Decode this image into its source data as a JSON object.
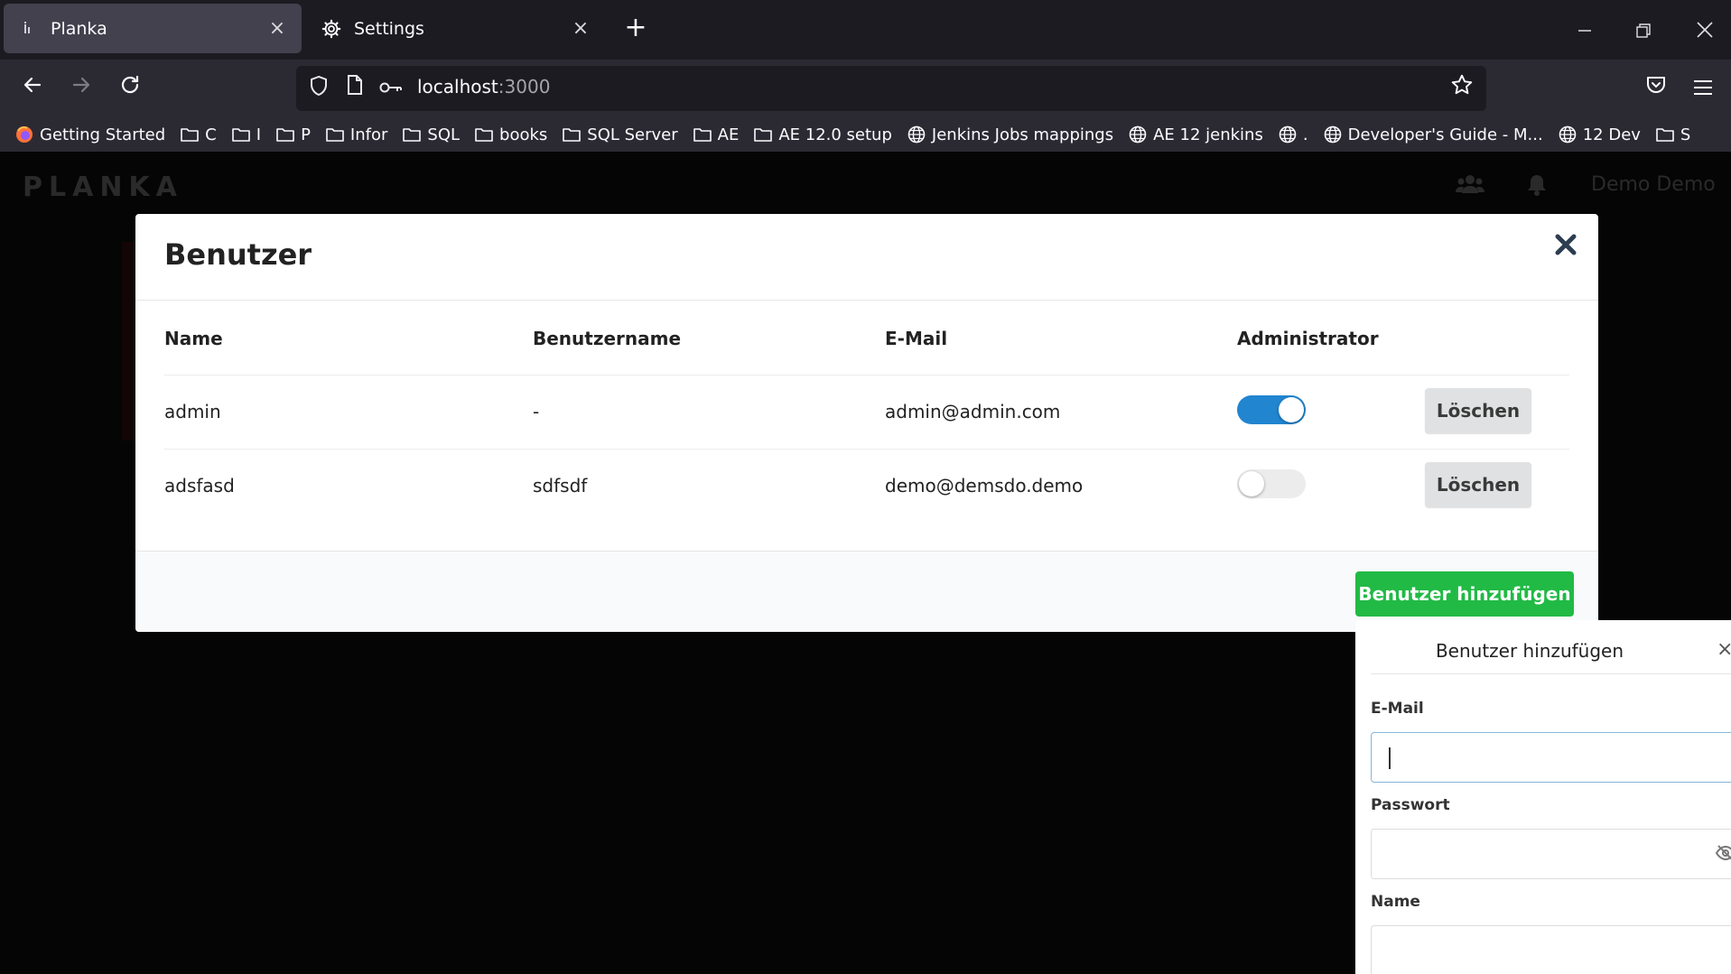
{
  "browser": {
    "tabs": [
      {
        "label": "Planka",
        "favicon": "planka-favicon-icon",
        "active": true
      },
      {
        "label": "Settings",
        "favicon": "gear-icon",
        "active": false
      }
    ],
    "url_host": "localhost",
    "url_port": ":3000",
    "bookmarks": [
      {
        "label": "Getting Started",
        "icon": "firefox-icon"
      },
      {
        "label": "C",
        "icon": "folder-icon"
      },
      {
        "label": "I",
        "icon": "folder-icon"
      },
      {
        "label": "P",
        "icon": "folder-icon"
      },
      {
        "label": "Infor",
        "icon": "folder-icon"
      },
      {
        "label": "SQL",
        "icon": "folder-icon"
      },
      {
        "label": "books",
        "icon": "folder-icon"
      },
      {
        "label": "SQL Server",
        "icon": "folder-icon"
      },
      {
        "label": "AE",
        "icon": "folder-icon"
      },
      {
        "label": "AE 12.0 setup",
        "icon": "folder-icon"
      },
      {
        "label": "Jenkins Jobs mappings",
        "icon": "globe-icon"
      },
      {
        "label": "AE 12 jenkins",
        "icon": "globe-icon"
      },
      {
        "label": ".",
        "icon": "globe-icon"
      },
      {
        "label": "Developer's Guide - M...",
        "icon": "globe-icon"
      },
      {
        "label": "12 Dev",
        "icon": "globe-icon"
      },
      {
        "label": "S",
        "icon": "folder-icon"
      }
    ]
  },
  "app": {
    "logo": "PLANKA",
    "user_name": "Demo Demo"
  },
  "modal": {
    "title": "Benutzer",
    "columns": [
      "Name",
      "Benutzername",
      "E-Mail",
      "Administrator"
    ],
    "rows": [
      {
        "name": "admin",
        "username": "-",
        "email": "admin@admin.com",
        "admin": true,
        "delete_label": "Löschen"
      },
      {
        "name": "adsfasd",
        "username": "sdfsdf",
        "email": "demo@demsdo.demo",
        "admin": false,
        "delete_label": "Löschen"
      }
    ],
    "add_button": "Benutzer hinzufügen"
  },
  "popup": {
    "title": "Benutzer hinzufügen",
    "email_label": "E-Mail",
    "password_label": "Passwort",
    "name_label": "Name",
    "email_value": "",
    "password_value": "",
    "name_value": ""
  },
  "colors": {
    "toggle_on": "#2185d0",
    "add_button": "#21ba45"
  }
}
